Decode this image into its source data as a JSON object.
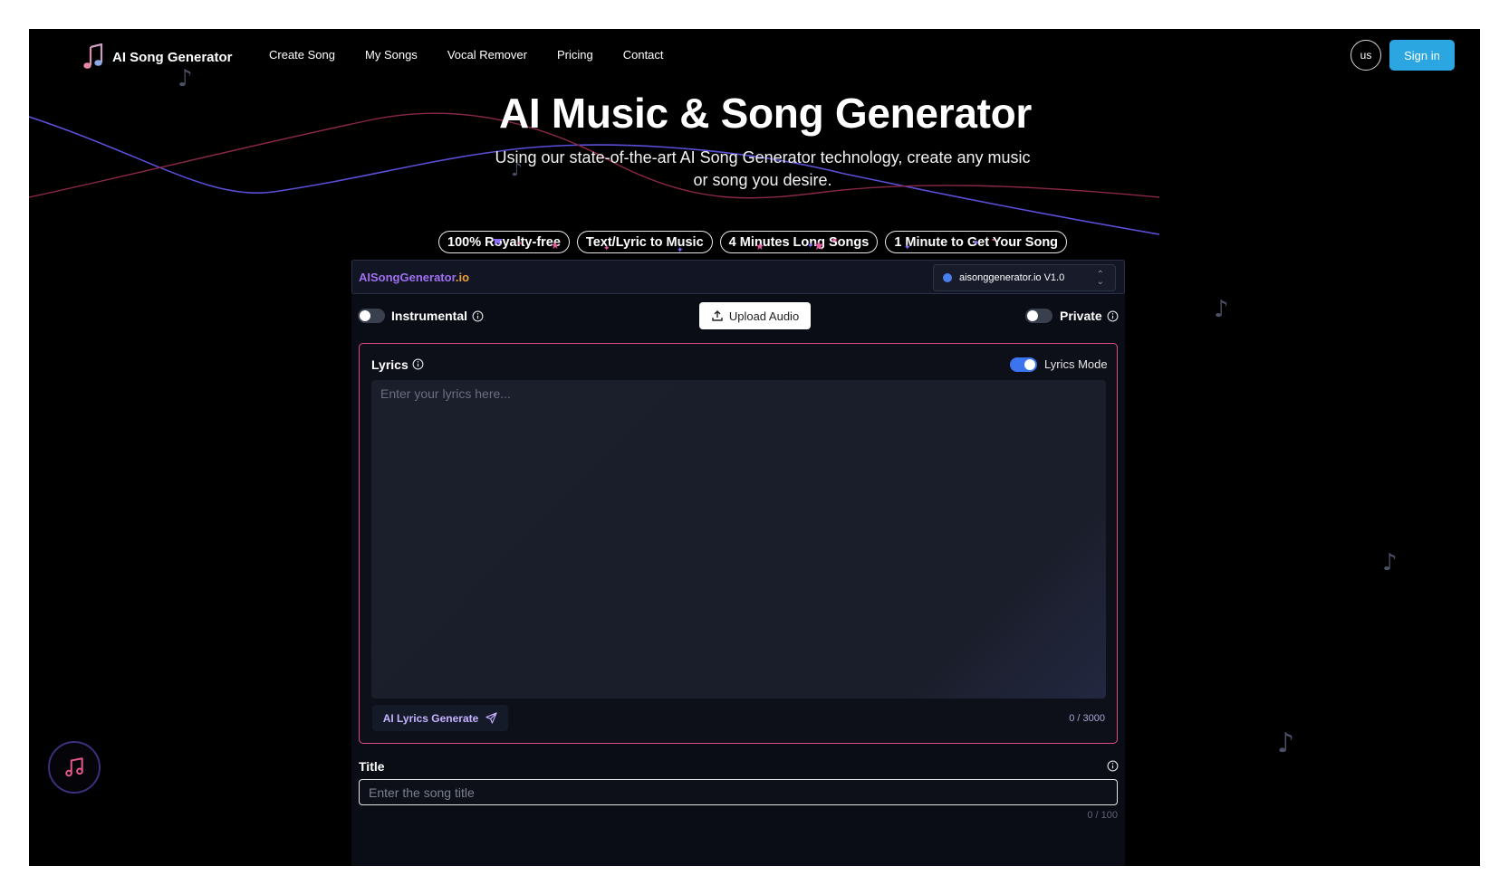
{
  "app": {
    "brand_name": "AI Song Generator",
    "nav": [
      "Create Song",
      "My Songs",
      "Vocal Remover",
      "Pricing",
      "Contact"
    ],
    "lang_label": "us",
    "signin_label": "Sign in"
  },
  "hero": {
    "title": "AI Music & Song Generator",
    "subtitle": "Using our state-of-the-art AI Song Generator technology, create any music or song you desire.",
    "badges": [
      "100% Royalty-free",
      "Text/Lyric to Music",
      "4 Minutes Long Songs",
      "1 Minute to Get Your Song"
    ]
  },
  "panel": {
    "brand_part1": "AISongGenerator",
    "brand_part2": ".io",
    "model_value": "aisonggenerator.io V1.0",
    "instrumental_label": "Instrumental",
    "instrumental_on": false,
    "upload_label": "Upload Audio",
    "private_label": "Private",
    "private_on": false
  },
  "lyrics": {
    "label": "Lyrics",
    "mode_label": "Lyrics Mode",
    "mode_on": true,
    "placeholder": "Enter your lyrics here...",
    "value": "",
    "ai_generate_label": "AI Lyrics Generate",
    "counter": "0 / 3000"
  },
  "title_field": {
    "label": "Title",
    "placeholder": "Enter the song title",
    "value": "",
    "counter": "0 / 100"
  },
  "icons": {
    "brand": "music-note-logo-icon",
    "info": "info-circle-icon",
    "upload": "upload-icon",
    "send": "paper-plane-icon",
    "chevron": "chevron-up-down-icon",
    "fab": "music-notes-icon",
    "background_notes": "music-note-icon"
  },
  "colors": {
    "background": "#000000",
    "accent_blue": "#2ba6e0",
    "toggle_on": "#3c74ef",
    "lyrics_border": "#e24a86",
    "brand_purple": "#a070f0",
    "brand_orange": "#f0a030"
  }
}
